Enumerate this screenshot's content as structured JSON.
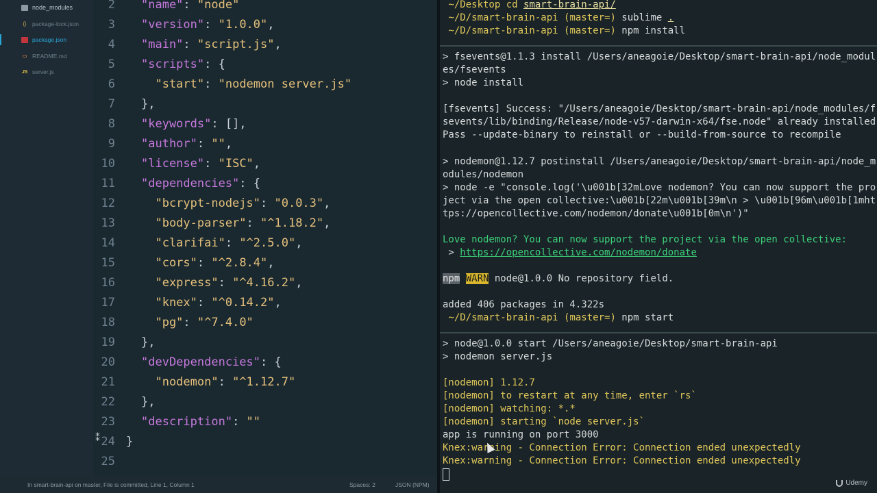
{
  "sidebar": {
    "items": [
      {
        "label": "node_modules",
        "icon": "folder-icon"
      },
      {
        "label": "package-lock.json",
        "icon": "json-file-icon"
      },
      {
        "label": "package.json",
        "icon": "package-file-icon"
      },
      {
        "label": "README.md",
        "icon": "markdown-file-icon"
      },
      {
        "label": "server.js",
        "icon": "js-file-icon"
      }
    ]
  },
  "editor": {
    "line_numbers": [
      "2",
      "3",
      "4",
      "5",
      "6",
      "7",
      "8",
      "9",
      "10",
      "11",
      "12",
      "13",
      "14",
      "15",
      "16",
      "17",
      "18",
      "19",
      "20",
      "21",
      "22",
      "23",
      "24",
      "25"
    ],
    "lines": [
      [
        {
          "t": "\"name\"",
          "c": "k"
        },
        {
          "t": ": ",
          "c": "p"
        },
        {
          "t": "\"node\"",
          "c": "s"
        }
      ],
      [
        {
          "t": "\"version\"",
          "c": "k"
        },
        {
          "t": ": ",
          "c": "p"
        },
        {
          "t": "\"1.0.0\"",
          "c": "s"
        },
        {
          "t": ",",
          "c": "p"
        }
      ],
      [
        {
          "t": "\"main\"",
          "c": "k"
        },
        {
          "t": ": ",
          "c": "p"
        },
        {
          "t": "\"script.js\"",
          "c": "s"
        },
        {
          "t": ",",
          "c": "p"
        }
      ],
      [
        {
          "t": "\"scripts\"",
          "c": "k"
        },
        {
          "t": ": {",
          "c": "p"
        }
      ],
      [
        {
          "t": "  \"start\"",
          "c": "s"
        },
        {
          "t": ": ",
          "c": "p"
        },
        {
          "t": "\"nodemon server.js\"",
          "c": "s"
        }
      ],
      [
        {
          "t": "},",
          "c": "p"
        }
      ],
      [
        {
          "t": "\"keywords\"",
          "c": "k"
        },
        {
          "t": ": [],",
          "c": "p"
        }
      ],
      [
        {
          "t": "\"author\"",
          "c": "k"
        },
        {
          "t": ": ",
          "c": "p"
        },
        {
          "t": "\"\"",
          "c": "s"
        },
        {
          "t": ",",
          "c": "p"
        }
      ],
      [
        {
          "t": "\"license\"",
          "c": "k"
        },
        {
          "t": ": ",
          "c": "p"
        },
        {
          "t": "\"ISC\"",
          "c": "s"
        },
        {
          "t": ",",
          "c": "p"
        }
      ],
      [
        {
          "t": "\"dependencies\"",
          "c": "k"
        },
        {
          "t": ": {",
          "c": "p"
        }
      ],
      [
        {
          "t": "  \"bcrypt-nodejs\"",
          "c": "s"
        },
        {
          "t": ": ",
          "c": "p"
        },
        {
          "t": "\"0.0.3\"",
          "c": "s"
        },
        {
          "t": ",",
          "c": "p"
        }
      ],
      [
        {
          "t": "  \"body-parser\"",
          "c": "s"
        },
        {
          "t": ": ",
          "c": "p"
        },
        {
          "t": "\"^1.18.2\"",
          "c": "s"
        },
        {
          "t": ",",
          "c": "p"
        }
      ],
      [
        {
          "t": "  \"clarifai\"",
          "c": "s"
        },
        {
          "t": ": ",
          "c": "p"
        },
        {
          "t": "\"^2.5.0\"",
          "c": "s"
        },
        {
          "t": ",",
          "c": "p"
        }
      ],
      [
        {
          "t": "  \"cors\"",
          "c": "s"
        },
        {
          "t": ": ",
          "c": "p"
        },
        {
          "t": "\"^2.8.4\"",
          "c": "s"
        },
        {
          "t": ",",
          "c": "p"
        }
      ],
      [
        {
          "t": "  \"express\"",
          "c": "s"
        },
        {
          "t": ": ",
          "c": "p"
        },
        {
          "t": "\"^4.16.2\"",
          "c": "s"
        },
        {
          "t": ",",
          "c": "p"
        }
      ],
      [
        {
          "t": "  \"knex\"",
          "c": "s"
        },
        {
          "t": ": ",
          "c": "p"
        },
        {
          "t": "\"^0.14.2\"",
          "c": "s"
        },
        {
          "t": ",",
          "c": "p"
        }
      ],
      [
        {
          "t": "  \"pg\"",
          "c": "s"
        },
        {
          "t": ": ",
          "c": "p"
        },
        {
          "t": "\"^7.4.0\"",
          "c": "s"
        }
      ],
      [
        {
          "t": "},",
          "c": "p"
        }
      ],
      [
        {
          "t": "\"devDependencies\"",
          "c": "k"
        },
        {
          "t": ": {",
          "c": "p"
        }
      ],
      [
        {
          "t": "  \"nodemon\"",
          "c": "s"
        },
        {
          "t": ": ",
          "c": "p"
        },
        {
          "t": "\"^1.12.7\"",
          "c": "s"
        }
      ],
      [
        {
          "t": "},",
          "c": "p"
        }
      ],
      [
        {
          "t": "\"description\"",
          "c": "k"
        },
        {
          "t": ": ",
          "c": "p"
        },
        {
          "t": "\"\"",
          "c": "s"
        }
      ],
      [
        {
          "t": "}",
          "c": "p"
        }
      ],
      []
    ]
  },
  "terminal": {
    "l1_prefix": " ~/Desktop ",
    "l1_cmd": "cd ",
    "l1_link": "smart-brain-api/",
    "l2_prefix": " ~/D/smart-brain-api ",
    "l2_branch": "(master=)",
    "l2_cmd": " sublime ",
    "l2_link": ".",
    "l3_prefix": " ~/D/smart-brain-api ",
    "l3_branch": "(master=)",
    "l3_cmd": " npm install",
    "l4": "> fsevents@1.1.3 install /Users/aneagoie/Desktop/smart-brain-api/node_modul",
    "l5": "es/fsevents",
    "l6": "> node install",
    "l7": "[fsevents] Success: \"/Users/aneagoie/Desktop/smart-brain-api/node_modules/f",
    "l8": "sevents/lib/binding/Release/node-v57-darwin-x64/fse.node\" already installed",
    "l9": "Pass --update-binary to reinstall or --build-from-source to recompile",
    "l10": "> nodemon@1.12.7 postinstall /Users/aneagoie/Desktop/smart-brain-api/node_m",
    "l11": "odules/nodemon",
    "l12": "> node -e \"console.log('\\u001b[32mLove nodemon? You can now support the pro",
    "l13": "ject via the open collective:\\u001b[22m\\u001b[39m\\n > \\u001b[96m\\u001b[1mht",
    "l14": "tps://opencollective.com/nodemon/donate\\u001b[0m\\n')\"",
    "l15": "Love nodemon? You can now support the project via the open collective:",
    "l16_prefix": " > ",
    "l16_link": "https://opencollective.com/nodemon/donate",
    "l17_npm": "npm",
    "l17_warn": "WARN",
    "l17_rest": " node@1.0.0 No repository field.",
    "l18": "added 406 packages in 4.322s",
    "l19_prefix": " ~/D/smart-brain-api ",
    "l19_branch": "(master=)",
    "l19_cmd": " npm start",
    "l20": "> node@1.0.0 start /Users/aneagoie/Desktop/smart-brain-api",
    "l21": "> nodemon server.js",
    "l22": "[nodemon] 1.12.7",
    "l23": "[nodemon] to restart at any time, enter `rs`",
    "l24": "[nodemon] watching: *.*",
    "l25": "[nodemon] starting `node server.js`",
    "l26": "app is running on port 3000",
    "l27": "Knex:warning - Connection Error: Connection ended unexpectedly",
    "l28": "Knex:warning - Connection Error: Connection ended unexpectedly"
  },
  "statusbar": {
    "left": "In smart-brain-api on master, File is committed, Line 1, Column 1",
    "spaces": "Spaces: 2",
    "syntax": "JSON (NPM)"
  },
  "watermark": "Udemy",
  "colors": {
    "accent": "#2aa6d6",
    "key_purple": "#c678dd",
    "string_yellow": "#e5c07b",
    "terminal_green": "#3ccf7a",
    "terminal_yellow": "#e0c75a"
  }
}
